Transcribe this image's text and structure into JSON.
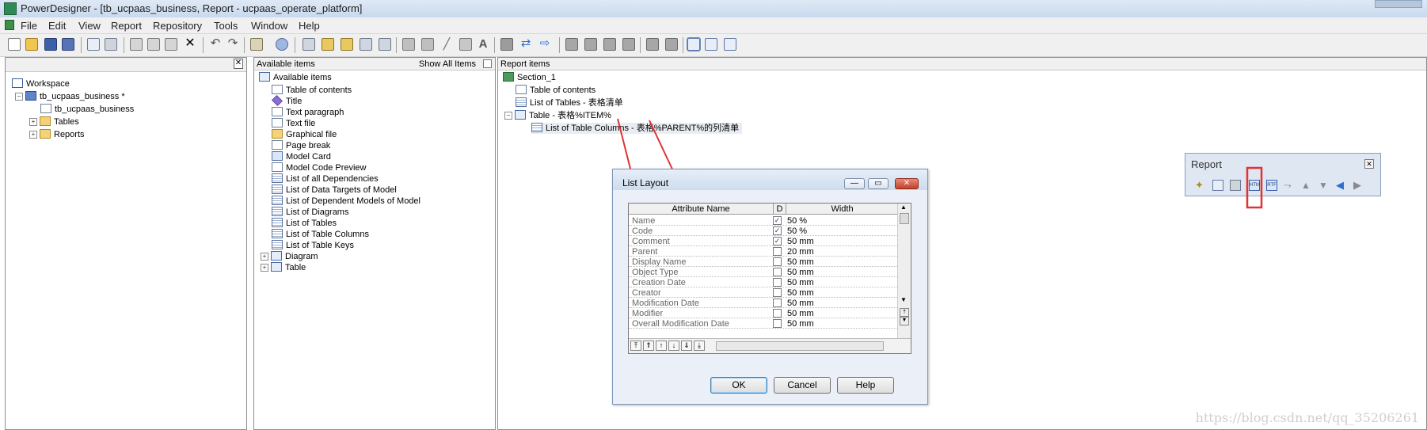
{
  "window": {
    "title": "PowerDesigner - [tb_ucpaas_business, Report - ucpaas_operate_platform]"
  },
  "menu": [
    "File",
    "Edit",
    "View",
    "Report",
    "Repository",
    "Tools",
    "Window",
    "Help"
  ],
  "workspace_tree": {
    "root": "Workspace",
    "model": "tb_ucpaas_business *",
    "diagram": "tb_ucpaas_business",
    "folders": [
      "Tables",
      "Reports"
    ]
  },
  "available": {
    "header": "Available items",
    "show_all": "Show All Items",
    "root": "Available items",
    "items": [
      "Table of contents",
      "Title",
      "Text paragraph",
      "Text file",
      "Graphical file",
      "Page break",
      "Model Card",
      "Model Code Preview",
      "List of all Dependencies",
      "List of Data Targets of Model",
      "List of Dependent Models of Model",
      "List of Diagrams",
      "List of Tables",
      "List of Table Columns",
      "List of Table Keys"
    ],
    "groups": [
      "Diagram",
      "Table"
    ]
  },
  "report": {
    "header": "Report items",
    "section": "Section_1",
    "items": [
      "Table of contents",
      "List of Tables - 表格清单",
      "Table - 表格%ITEM%"
    ],
    "child": "List of Table Columns - 表格%PARENT%的列清单"
  },
  "dialog": {
    "title": "List Layout",
    "columns": [
      "Attribute Name",
      "D",
      "Width"
    ],
    "rows": [
      {
        "name": "Name",
        "checked": true,
        "width": "50 %"
      },
      {
        "name": "Code",
        "checked": true,
        "width": "50 %"
      },
      {
        "name": "Comment",
        "checked": true,
        "width": "50 mm"
      },
      {
        "name": "Parent",
        "checked": false,
        "width": "20 mm"
      },
      {
        "name": "Display Name",
        "checked": false,
        "width": "50 mm"
      },
      {
        "name": "Object Type",
        "checked": false,
        "width": "50 mm"
      },
      {
        "name": "Creation Date",
        "checked": false,
        "width": "50 mm"
      },
      {
        "name": "Creator",
        "checked": false,
        "width": "50 mm"
      },
      {
        "name": "Modification Date",
        "checked": false,
        "width": "50 mm"
      },
      {
        "name": "Modifier",
        "checked": false,
        "width": "50 mm"
      },
      {
        "name": "Overall Modification Date",
        "checked": false,
        "width": "50 mm"
      }
    ],
    "buttons": {
      "ok": "OK",
      "cancel": "Cancel",
      "help": "Help"
    }
  },
  "report_toolbar": {
    "title": "Report"
  },
  "watermark": "https://blog.csdn.net/qq_35206261",
  "colors": {
    "highlight_red": "#e23232"
  }
}
